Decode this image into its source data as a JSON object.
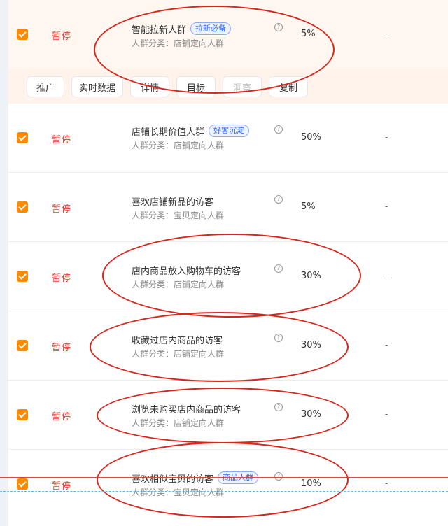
{
  "rows": [
    {
      "status": "暂停",
      "name": "智能拉新人群",
      "tag": "拉新必备",
      "category": "人群分类：店铺定向人群",
      "help_icon": "question-circle-icon",
      "ratio": "5%",
      "dash": "-"
    },
    {
      "status": "暂停",
      "name": "店铺长期价值人群",
      "tag": "好客沉淀",
      "category": "人群分类：店铺定向人群",
      "help_icon": "question-circle-icon",
      "ratio": "50%",
      "dash": "-"
    },
    {
      "status": "暂停",
      "name": "喜欢店铺新品的访客",
      "tag": "",
      "category": "人群分类：宝贝定向人群",
      "help_icon": "question-circle-icon",
      "ratio": "5%",
      "dash": "-"
    },
    {
      "status": "暂停",
      "name": "店内商品放入购物车的访客",
      "tag": "",
      "category": "人群分类：店铺定向人群",
      "help_icon": "question-circle-icon",
      "ratio": "30%",
      "dash": "-"
    },
    {
      "status": "暂停",
      "name": "收藏过店内商品的访客",
      "tag": "",
      "category": "人群分类：店铺定向人群",
      "help_icon": "question-circle-icon",
      "ratio": "30%",
      "dash": "-"
    },
    {
      "status": "暂停",
      "name": "浏览未购买店内商品的访客",
      "tag": "",
      "category": "人群分类：店铺定向人群",
      "help_icon": "question-circle-icon",
      "ratio": "30%",
      "dash": "-"
    },
    {
      "status": "暂停",
      "name": "喜欢相似宝贝的访客",
      "tag": "商品人群",
      "category": "人群分类：宝贝定向人群",
      "help_icon": "question-circle-icon",
      "ratio": "10%",
      "dash": "-"
    }
  ],
  "actions": [
    "推广",
    "实时数据",
    "详情",
    "目标",
    "洞察",
    "复制"
  ],
  "colors": {
    "accent": "#ff8a00",
    "status_red": "#e83b2e",
    "tag_blue": "#2f6bff",
    "annotation_red": "#d9251c",
    "selected_bg": "#fff7f0"
  }
}
